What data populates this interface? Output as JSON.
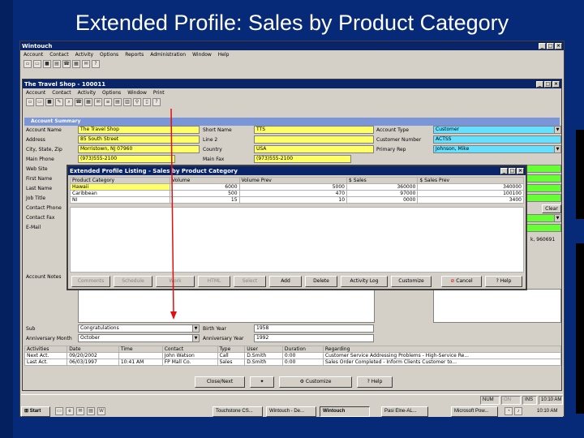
{
  "slide_title": "Extended Profile: Sales by Product Category",
  "app": {
    "title": "Wintouch",
    "menu": [
      "Account",
      "Contact",
      "Activity",
      "Options",
      "Reports",
      "Administration",
      "Window",
      "Help"
    ]
  },
  "child": {
    "title": "The Travel Shop - 100011",
    "menu": [
      "Account",
      "Contact",
      "Activity",
      "Options",
      "Window",
      "Print"
    ],
    "section": "Account Summary"
  },
  "form": {
    "account_name_label": "Account Name",
    "account_name": "The Travel Shop",
    "address_label": "Address",
    "address": "85 South Street",
    "city_label": "City, State, Zip",
    "city": "Morristown, NJ 07960",
    "main_phone_label": "Main Phone",
    "main_phone": "(973)555-2100",
    "web_site_label": "Web Site",
    "first_name_label": "First Name",
    "last_name_label": "Last Name",
    "job_title_label": "Job Title",
    "contact_phone_label": "Contact Phone",
    "contact_fax_label": "Contact Fax",
    "email_label": "E-Mail",
    "account_notes_label": "Account Notes",
    "short_name_label": "Short Name",
    "short_name": "TTS",
    "line2_label": "Line 2",
    "country_label": "Country",
    "country": "USA",
    "main_fax_label": "Main Fax",
    "main_fax": "(973)555-2100",
    "account_type_label": "Account Type",
    "account_type": "Customer",
    "customer_number_label": "Customer Number",
    "customer_number": "ACTSS",
    "primary_rep_label": "Primary Rep",
    "primary_rep": "Johnson, Mike",
    "clear_label": "Clear",
    "side_note": "k, 960691",
    "sub_label": "Sub",
    "anniv_note": "Congratulations",
    "birth_year_label": "Birth Year",
    "birth_year": "1958",
    "anniversary_month_label": "Anniversary Month",
    "anniversary_month": "October",
    "anniversary_year_label": "Anniversary Year",
    "anniversary_year": "1992"
  },
  "activities": {
    "columns": [
      "Activities",
      "Date",
      "Time",
      "Contact",
      "Type",
      "User",
      "Duration",
      "Regarding"
    ],
    "rows": [
      [
        "Next Act.",
        "09/20/2002",
        "",
        "John Watson",
        "Call",
        "D.Smith",
        "0:00",
        "Customer Service Addressing Problems - High-Service Re..."
      ],
      [
        "Last Act.",
        "06/03/1997",
        "10:41 AM",
        "FP Mall Co.",
        "Sales",
        "D.Smith",
        "0:00",
        "Sales Order Completed - Inform Clients Customer to..."
      ]
    ]
  },
  "bottom_buttons": [
    "Close/Next",
    "",
    "Customize",
    "Help"
  ],
  "dialog": {
    "title": "Extended Profile Listing - Sales by Product Category",
    "columns": [
      "Product Category",
      "Volume",
      "Volume Prev",
      "$ Sales",
      "$ Sales Prev"
    ],
    "rows": [
      [
        "Hawaii",
        "6000",
        "5000",
        "360000",
        "340000"
      ],
      [
        "Caribbean",
        "500",
        "470",
        "97000",
        "100100"
      ],
      [
        "NI",
        "15",
        "10",
        "0000",
        "3400"
      ]
    ],
    "buttons": [
      "Comments",
      "Schedule",
      "Work",
      "HTML",
      "Select",
      "Add",
      "Delete",
      "Activity Log",
      "Customize",
      "Cancel",
      "Help"
    ]
  },
  "taskbar": {
    "start": "Start",
    "tasks": [
      "Touchstone CS...",
      "Wintouch - De...",
      "Wintouch",
      "Pasi Elne-AL...",
      "Microsoft Pow..."
    ],
    "status": [
      "NUM",
      "ON",
      "INS",
      "10:10 AM"
    ],
    "clock": "10:10 AM"
  },
  "colors": {
    "title_bar": "#0a246a",
    "yellow": "#ffff66",
    "cyan": "#66e0ff",
    "green": "#66ff33",
    "arrow": "#e01010"
  }
}
